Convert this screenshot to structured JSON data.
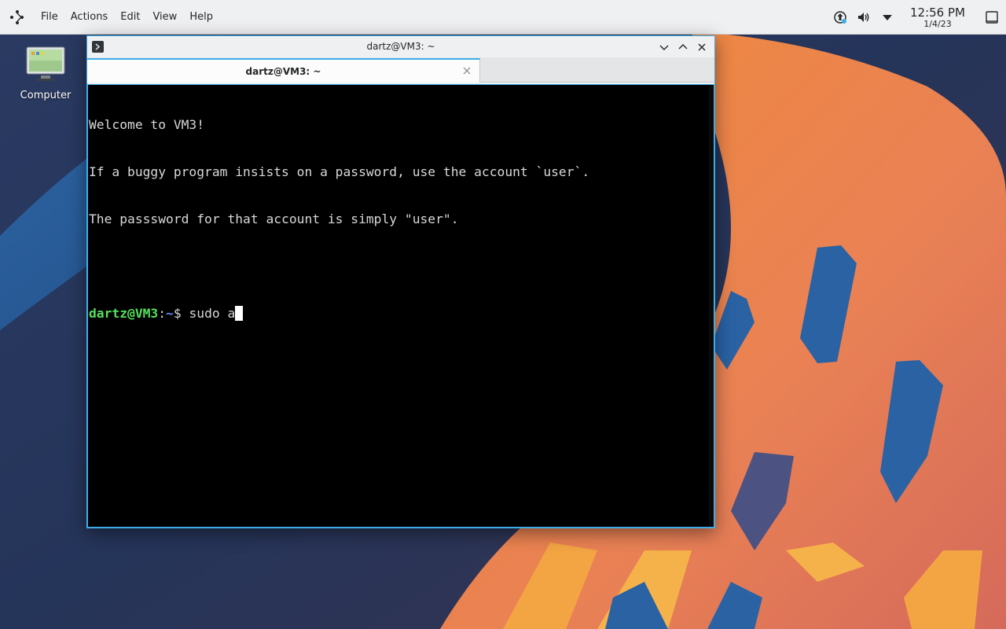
{
  "panel": {
    "menu": [
      "File",
      "Actions",
      "Edit",
      "View",
      "Help"
    ],
    "clock": {
      "time": "12:56 PM",
      "date": "1/4/23"
    }
  },
  "desktop": {
    "icons": [
      {
        "label": "Computer",
        "icon": "computer-icon"
      }
    ]
  },
  "window": {
    "title": "dartz@VM3: ~",
    "tab_label": "dartz@VM3: ~",
    "buttons": [
      "minimize",
      "maximize",
      "close"
    ]
  },
  "terminal": {
    "lines": [
      "Welcome to VM3!",
      "If a buggy program insists on a password, use the account `user`.",
      "The passsword for that account is simply \"user\".",
      ""
    ],
    "prompt": {
      "user_host": "dartz@VM3",
      "separator": ":",
      "path": "~",
      "symbol": "$ ",
      "command": "sudo a"
    }
  },
  "colors": {
    "accent": "#3daee9",
    "prompt_user": "#55e05a",
    "prompt_path": "#5a8cf5",
    "terminal_bg": "#000000",
    "terminal_fg": "#d8d8d8"
  }
}
